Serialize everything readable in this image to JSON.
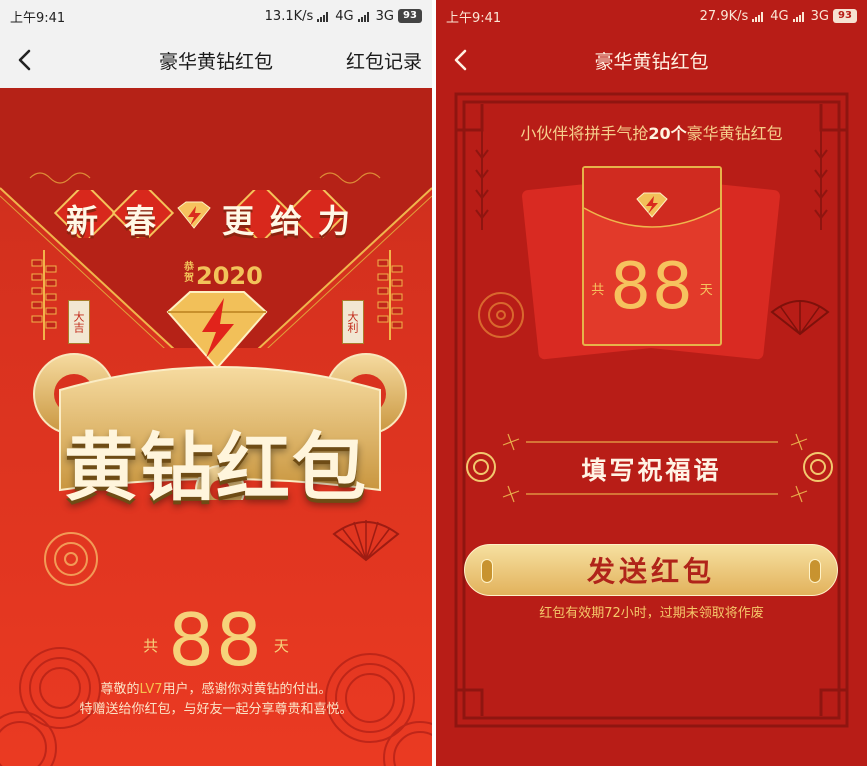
{
  "left": {
    "status": {
      "time": "上午9:41",
      "speed": "13.1K/s",
      "net1": "4G",
      "net2": "3G",
      "battery": "93"
    },
    "nav": {
      "title": "豪华黄钻红包",
      "action": "红包记录"
    },
    "banner": {
      "c1": "新",
      "c2": "春",
      "c3": "更",
      "c4": "给",
      "c5": "力"
    },
    "year": {
      "prefix": "恭贺",
      "number": "2020"
    },
    "tags": {
      "left": "大吉",
      "right": "大利"
    },
    "seal_title": "黄钻红包",
    "days": {
      "prefix": "共",
      "value": "88",
      "unit": "天"
    },
    "greeting": {
      "line1_a": "尊敬的",
      "line1_level": "LV7",
      "line1_b": "用户，感谢你对黄钻的付出。",
      "line2": "特赠送给你红包，与好友一起分享尊贵和喜悦。"
    }
  },
  "right": {
    "status": {
      "time": "上午9:41",
      "speed": "27.9K/s",
      "net1": "4G",
      "net2": "3G",
      "battery": "93"
    },
    "nav": {
      "title": "豪华黄钻红包"
    },
    "headline": {
      "a": "小伙伴将拼手气抢",
      "count": "20个",
      "b": "豪华黄钻红包"
    },
    "days": {
      "prefix": "共",
      "value": "88",
      "unit": "天"
    },
    "blessing_input": "填写祝福语",
    "send_button": "发送红包",
    "note": "红包有效期72小时，过期未领取将作废"
  },
  "colors": {
    "gold": "#f6c25e",
    "red": "#e8351f",
    "dark_red": "#b81d17"
  },
  "icons": [
    "back-chevron-icon",
    "signal-icon",
    "battery-icon",
    "diamond-lightning-icon",
    "firecracker-icon",
    "fan-icon",
    "flower-icon"
  ]
}
